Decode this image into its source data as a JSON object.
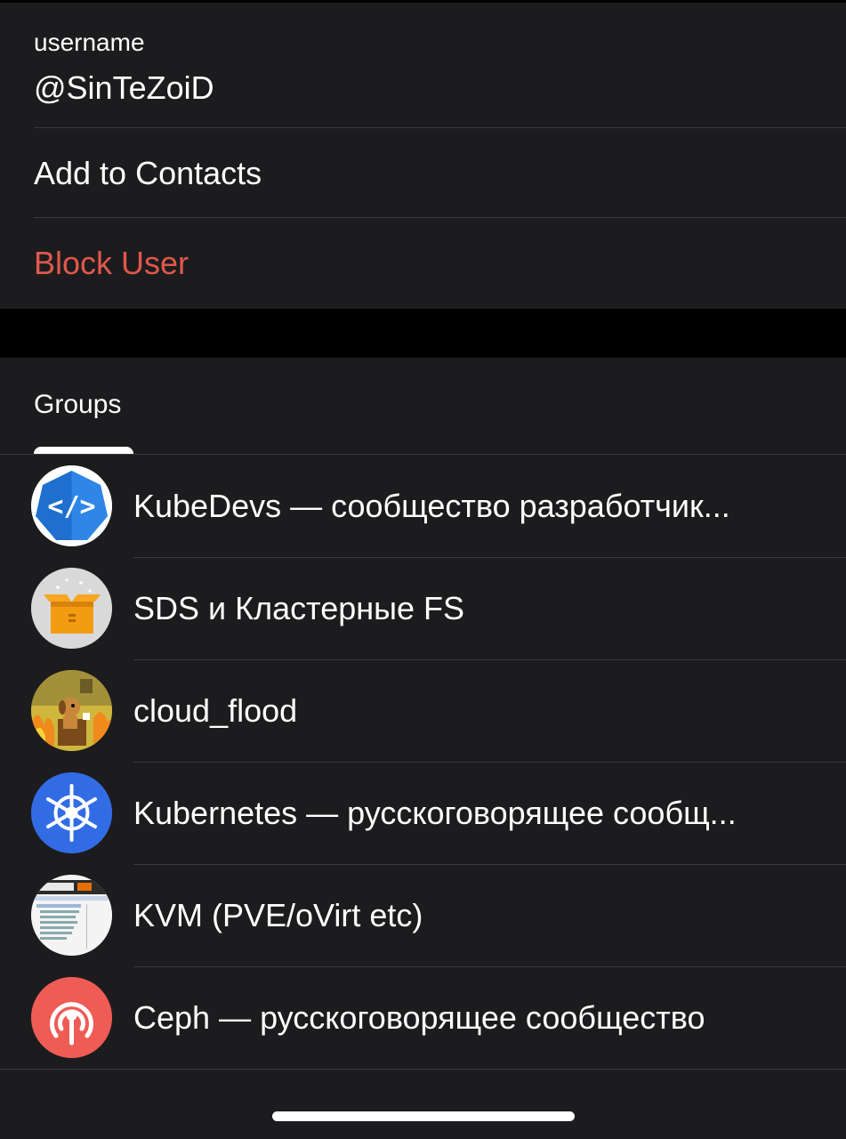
{
  "profile": {
    "username_label": "username",
    "username_value": "@SinTeZoiD",
    "add_to_contacts": "Add to Contacts",
    "block_user": "Block User"
  },
  "groups": {
    "header": "Groups",
    "items": [
      {
        "title": "KubeDevs — сообщество разработчик...",
        "avatar_icon": "code-brackets-icon"
      },
      {
        "title": "SDS и Кластерные FS",
        "avatar_icon": "open-box-icon"
      },
      {
        "title": "cloud_flood",
        "avatar_icon": "this-is-fine-dog-icon"
      },
      {
        "title": "Kubernetes — русскоговорящее сообщ...",
        "avatar_icon": "helm-wheel-icon"
      },
      {
        "title": "KVM (PVE/oVirt etc)",
        "avatar_icon": "proxmox-screenshot-icon"
      },
      {
        "title": "Ceph — русскоговорящее сообщество",
        "avatar_icon": "ceph-logo-icon"
      }
    ]
  },
  "colors": {
    "card_background": "#1c1c1e",
    "separator": "#3a3a3c",
    "destructive": "#e0584b",
    "kubernetes_blue": "#326ce5"
  }
}
